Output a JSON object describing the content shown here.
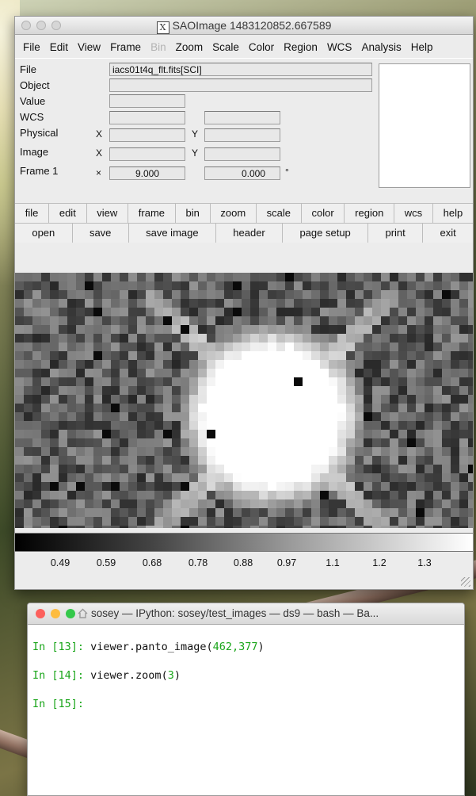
{
  "window": {
    "title": "SAOImage 1483120852.667589",
    "menu": [
      "File",
      "Edit",
      "View",
      "Frame",
      "Bin",
      "Zoom",
      "Scale",
      "Color",
      "Region",
      "WCS",
      "Analysis",
      "Help"
    ],
    "menu_disabled": [
      "Bin"
    ]
  },
  "info": {
    "labels": {
      "file": "File",
      "object": "Object",
      "value": "Value",
      "wcs": "WCS",
      "physical": "Physical",
      "image": "Image",
      "frame": "Frame 1"
    },
    "file_value": "iacs01t4q_flt.fits[SCI]",
    "axis_x": "X",
    "axis_y": "Y",
    "frame_x_label": "×",
    "zoom_value": "9.000",
    "angle_value": "0.000",
    "degree": "°"
  },
  "buttons_top": [
    "file",
    "edit",
    "view",
    "frame",
    "bin",
    "zoom",
    "scale",
    "color",
    "region",
    "wcs",
    "help"
  ],
  "buttons_bottom": [
    "open",
    "save",
    "save image",
    "header",
    "page setup",
    "print",
    "exit"
  ],
  "colorbar": {
    "ticks": [
      "0.49",
      "0.59",
      "0.68",
      "0.78",
      "0.88",
      "0.97",
      "1.1",
      "1.2",
      "1.3"
    ]
  },
  "terminal": {
    "title": "sosey — IPython: sosey/test_images — ds9 — bash — Ba...",
    "lines": [
      {
        "prompt": "In [13]:",
        "code": " viewer.panto_image(",
        "nums": "462,377",
        "tail": ")"
      },
      {
        "prompt": "In [14]:",
        "code": " viewer.zoom(",
        "nums": "3",
        "tail": ")"
      },
      {
        "prompt": "In [15]:",
        "code": "",
        "nums": "",
        "tail": ""
      }
    ],
    "traffic_colors": [
      "#fc605c",
      "#fdbc40",
      "#34c84a"
    ]
  }
}
